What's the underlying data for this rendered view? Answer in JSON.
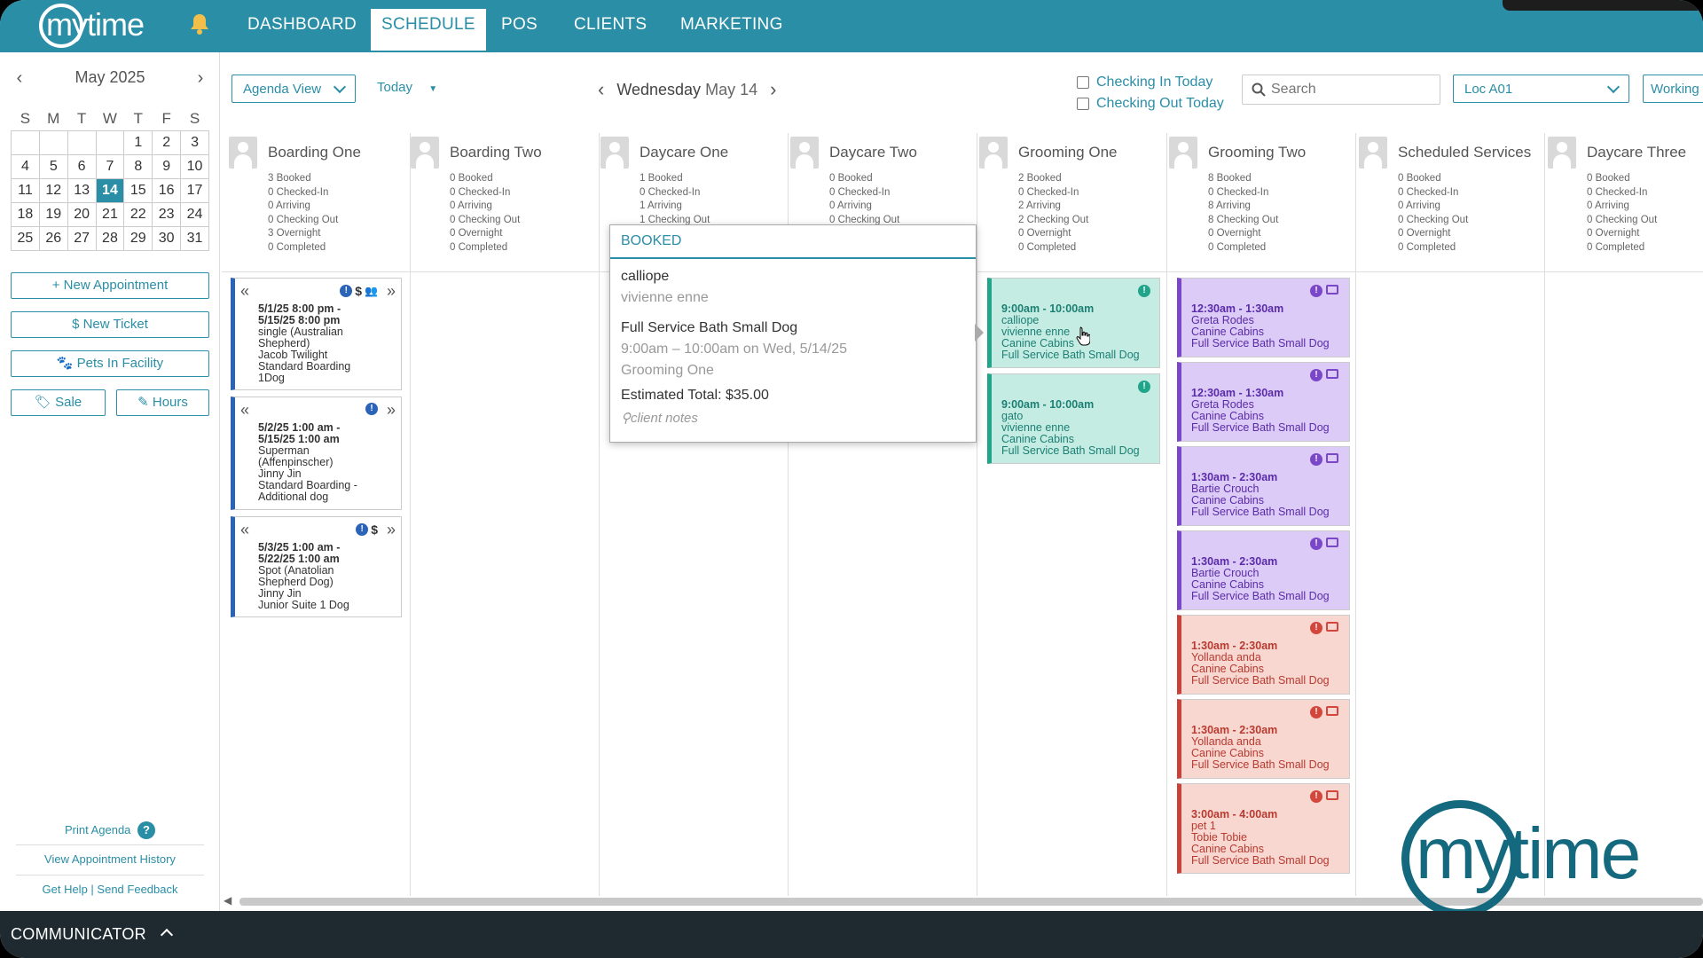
{
  "nav": {
    "logo": "mytime",
    "items": [
      "DASHBOARD",
      "SCHEDULE",
      "POS",
      "CLIENTS",
      "MARKETING"
    ],
    "active": "SCHEDULE"
  },
  "calendar": {
    "month": "May 2025",
    "weekdays": [
      "S",
      "M",
      "T",
      "W",
      "T",
      "F",
      "S"
    ],
    "weeks": [
      [
        "",
        "",
        "",
        "",
        "1",
        "2",
        "3"
      ],
      [
        "4",
        "5",
        "6",
        "7",
        "8",
        "9",
        "10"
      ],
      [
        "11",
        "12",
        "13",
        "14",
        "15",
        "16",
        "17"
      ],
      [
        "18",
        "19",
        "20",
        "21",
        "22",
        "23",
        "24"
      ],
      [
        "25",
        "26",
        "27",
        "28",
        "29",
        "30",
        "31"
      ]
    ],
    "selected": "14"
  },
  "sidebar": {
    "new_appointment": "+ New Appointment",
    "new_ticket": "$  New Ticket",
    "pets_in_facility": "Pets In Facility",
    "sale": "Sale",
    "hours": "Hours",
    "print_agenda": "Print Agenda",
    "view_history": "View Appointment History",
    "get_help": "Get Help",
    "send_feedback": "Send Feedback"
  },
  "toolbar": {
    "view": "Agenda View",
    "today": "Today",
    "date_prefix": "Wednesday",
    "date": "May 14",
    "checking_in": "Checking In Today",
    "checking_out": "Checking Out Today",
    "search_placeholder": "Search",
    "location": "Loc A01",
    "working": "Working"
  },
  "resources": [
    {
      "name": "Boarding One",
      "stats": [
        "3 Booked",
        "0 Checked-In",
        "0 Arriving",
        "0 Checking Out",
        "3 Overnight",
        "0 Completed"
      ]
    },
    {
      "name": "Boarding Two",
      "stats": [
        "0 Booked",
        "0 Checked-In",
        "0 Arriving",
        "0 Checking Out",
        "0 Overnight",
        "0 Completed"
      ]
    },
    {
      "name": "Daycare One",
      "stats": [
        "1 Booked",
        "0 Checked-In",
        "1 Arriving",
        "1 Checking Out",
        "",
        ""
      ]
    },
    {
      "name": "Daycare Two",
      "stats": [
        "0 Booked",
        "0 Checked-In",
        "0 Arriving",
        "0 Checking Out",
        "",
        ""
      ]
    },
    {
      "name": "Grooming One",
      "stats": [
        "2 Booked",
        "0 Checked-In",
        "2 Arriving",
        "2 Checking Out",
        "0 Overnight",
        "0 Completed"
      ]
    },
    {
      "name": "Grooming Two",
      "stats": [
        "8 Booked",
        "0 Checked-In",
        "8 Arriving",
        "8 Checking Out",
        "0 Overnight",
        "0 Completed"
      ]
    },
    {
      "name": "Scheduled Services",
      "stats": [
        "0 Booked",
        "0 Checked-In",
        "0 Arriving",
        "0 Checking Out",
        "0 Overnight",
        "0 Completed"
      ]
    },
    {
      "name": "Daycare Three",
      "stats": [
        "0 Booked",
        "0 Checked-In",
        "0 Arriving",
        "0 Checking Out",
        "0 Overnight",
        "0 Completed"
      ]
    }
  ],
  "boarding_cards": [
    {
      "lines_bold": [
        "5/1/25 8:00 pm -",
        "5/15/25 8:00 pm"
      ],
      "lines": [
        "single (Australian",
        "Shepherd)",
        "Jacob Twilight",
        "Standard Boarding",
        "1Dog"
      ],
      "icons": "$"
    },
    {
      "lines_bold": [
        "5/2/25 1:00 am -",
        "5/15/25 1:00 am"
      ],
      "lines": [
        "Superman",
        "(Affenpinscher)",
        "Jinny Jin",
        "Standard Boarding -",
        "Additional dog"
      ],
      "icons": ""
    },
    {
      "lines_bold": [
        "5/3/25 1:00 am -",
        "5/22/25 1:00 am"
      ],
      "lines": [
        "Spot (Anatolian",
        "Shepherd Dog)",
        "Jinny Jin",
        "Junior Suite 1 Dog"
      ],
      "icons": "$"
    }
  ],
  "popover": {
    "status": "BOOKED",
    "pet": "calliope",
    "owner": "vivienne enne",
    "service": "Full Service Bath Small Dog",
    "when": "9:00am – 10:00am on Wed, 5/14/25",
    "resource": "Grooming One",
    "total": "Estimated Total: $35.00",
    "notes": "client notes"
  },
  "grooming_one_cards": [
    {
      "time": "9:00am - 10:00am",
      "lines": [
        "calliope",
        "vivienne enne",
        "Canine Cabins",
        "Full Service Bath Small Dog"
      ]
    },
    {
      "time": "9:00am - 10:00am",
      "lines": [
        "gato",
        "vivienne enne",
        "Canine Cabins",
        "Full Service Bath Small Dog"
      ]
    }
  ],
  "grooming_two_cards": [
    {
      "color": "purple",
      "time": "12:30am - 1:30am",
      "lines": [
        "Greta Rodes",
        "Canine Cabins",
        "Full Service Bath Small Dog"
      ]
    },
    {
      "color": "purple",
      "time": "12:30am - 1:30am",
      "lines": [
        "Greta Rodes",
        "Canine Cabins",
        "Full Service Bath Small Dog"
      ]
    },
    {
      "color": "purple",
      "time": "1:30am - 2:30am",
      "lines": [
        "Bartie Crouch",
        "Canine Cabins",
        "Full Service Bath Small Dog"
      ]
    },
    {
      "color": "purple",
      "time": "1:30am - 2:30am",
      "lines": [
        "Bartie Crouch",
        "Canine Cabins",
        "Full Service Bath Small Dog"
      ]
    },
    {
      "color": "red",
      "time": "1:30am - 2:30am",
      "lines": [
        "Yollanda anda",
        "Canine Cabins",
        "Full Service Bath Small Dog"
      ]
    },
    {
      "color": "red",
      "time": "1:30am - 2:30am",
      "lines": [
        "Yollanda anda",
        "Canine Cabins",
        "Full Service Bath Small Dog"
      ]
    },
    {
      "color": "red",
      "time": "3:00am - 4:00am",
      "lines": [
        "pet 1",
        "Tobie Tobie",
        "Canine Cabins",
        "Full Service Bath Small Dog"
      ]
    }
  ],
  "communicator": "COMMUNICATOR",
  "colors": {
    "brand": "#2a8ea6",
    "teal_card": "#c5ece3",
    "purple_card": "#dccaf7",
    "red_card": "#f7d7d0"
  }
}
